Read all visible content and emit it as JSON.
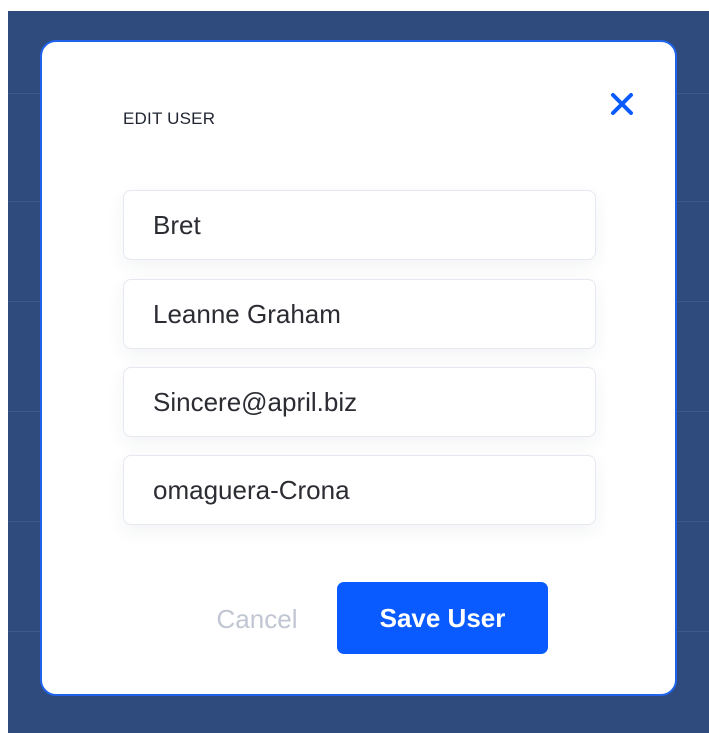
{
  "modal": {
    "title": "EDIT USER",
    "close_icon": "close-icon",
    "fields": {
      "username": "Bret",
      "name": "Leanne Graham",
      "email": "Sincere@april.biz",
      "company": "omaguera-Crona"
    },
    "actions": {
      "cancel_label": "Cancel",
      "save_label": "Save User"
    }
  },
  "colors": {
    "backdrop": "#2f4a7d",
    "modal_border": "#1f63ea",
    "accent": "#0a5bff",
    "cancel_text": "#c1c6d3"
  }
}
